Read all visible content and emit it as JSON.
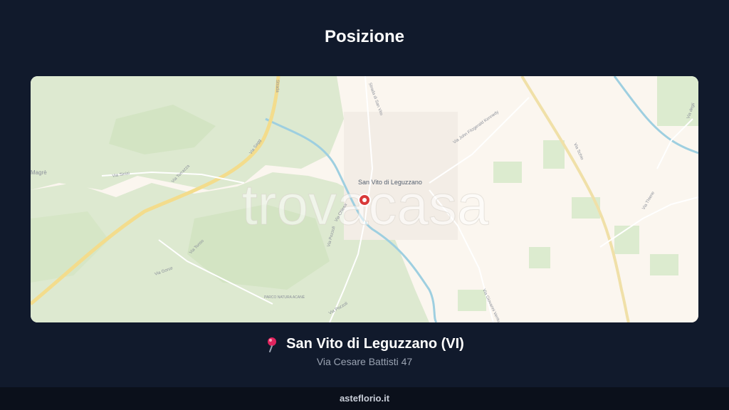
{
  "header": {
    "title": "Posizione"
  },
  "map": {
    "watermark": "trovacasa",
    "place_labels": {
      "town": "San Vito di Leguzzano",
      "magre": "Magrè",
      "park": "PARCO NATURA ACANÈ"
    },
    "street_labels": {
      "strada_san_vito": "Strada di San Vito",
      "via_kennedy": "Via John Fitzgerald Kennedy",
      "via_schio": "Via Schio",
      "via_degli": "Via degli",
      "via_thiene": "Via Thiene",
      "via_chiesa": "Via Chiesa",
      "via_pozzoli_1": "Via Pozzoli",
      "via_pozzoli_2": "Via Pozzoli",
      "via_giovanni": "Via Giovanni Ventu",
      "via_sinisi": "Via Sinisi",
      "via_torrazza": "Via Torrazza",
      "via_tonso": "Via Tonso",
      "via_gorse": "Via Gorse",
      "via_sagg": "Via Sagg",
      "strada_top": "Strada"
    },
    "colors": {
      "marker": "#d93a3a",
      "forest": "#d9e8cc",
      "water": "#9ecfe0",
      "road": "#f3dc8c"
    }
  },
  "location": {
    "pin_icon": "map-pin-icon",
    "title": "San Vito di Leguzzano (VI)",
    "address": "Via Cesare Battisti 47"
  },
  "footer": {
    "brand": "asteflorio.it"
  }
}
